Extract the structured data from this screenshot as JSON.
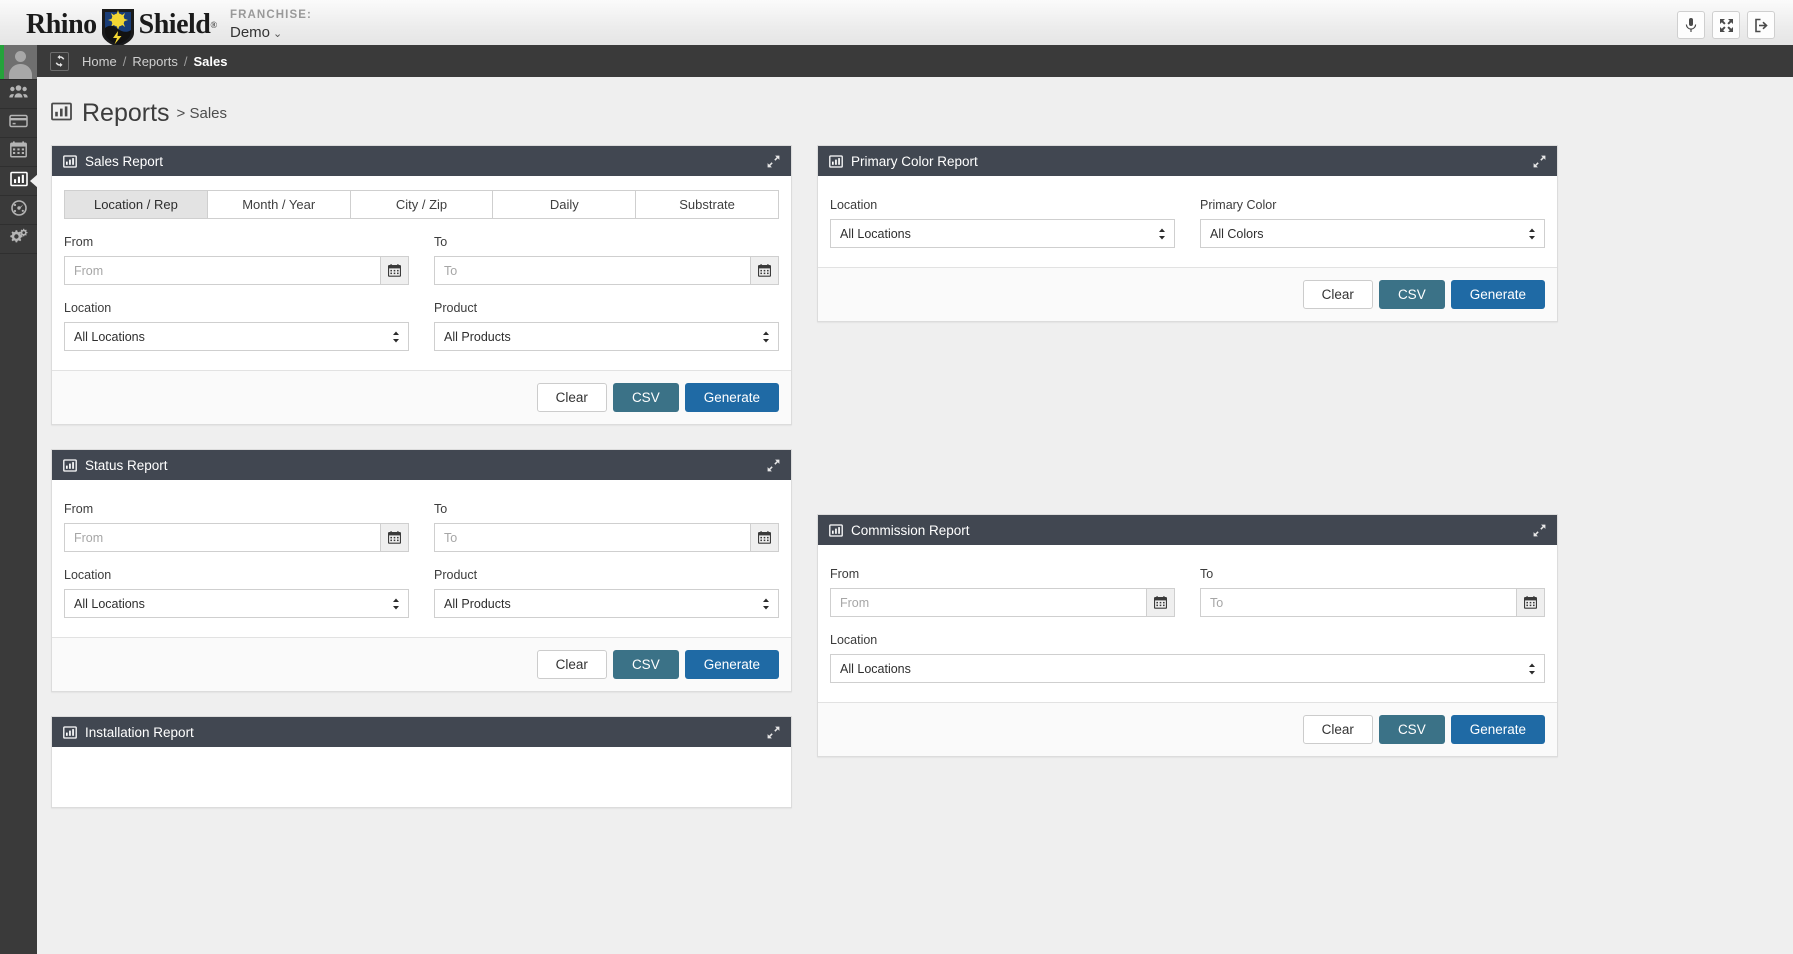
{
  "topbar": {
    "logo_text_1": "Rhino",
    "logo_text_2": "Shield",
    "logo_tm": "®",
    "franchise_label": "FRANCHISE:",
    "franchise_value": "Demo",
    "franchise_caret": "⌄",
    "actions": [
      {
        "name": "microphone-icon",
        "title": "Voice"
      },
      {
        "name": "fullscreen-icon",
        "title": "Fullscreen"
      },
      {
        "name": "logout-icon",
        "title": "Logout"
      }
    ]
  },
  "sidebar": {
    "items": [
      {
        "name": "avatar",
        "label": "User Avatar"
      },
      {
        "name": "sidebar-item-customers",
        "label": "Customers"
      },
      {
        "name": "sidebar-item-payments",
        "label": "Payments"
      },
      {
        "name": "sidebar-item-calendar",
        "label": "Calendar"
      },
      {
        "name": "sidebar-item-reports",
        "label": "Reports",
        "active": true
      },
      {
        "name": "sidebar-item-dashboard",
        "label": "Dashboard"
      },
      {
        "name": "sidebar-item-settings",
        "label": "Settings"
      }
    ]
  },
  "breadcrumb": {
    "refresh": "⟳",
    "home": "Home",
    "sep": "/",
    "reports": "Reports",
    "current": "Sales"
  },
  "page": {
    "title": "Reports",
    "subtitle": "> Sales"
  },
  "common": {
    "from_label": "From",
    "to_label": "To",
    "location_label": "Location",
    "product_label": "Product",
    "from_placeholder": "From",
    "to_placeholder": "To",
    "all_locations": "All Locations",
    "all_products": "All Products",
    "clear_label": "Clear",
    "csv_label": "CSV",
    "generate_label": "Generate",
    "expand_icon": "expand-icon"
  },
  "colors": {
    "panel_header": "#414751",
    "sidebar": "#3a3a3a",
    "csv_button": "#3b7287",
    "generate_button": "#1f6aa5",
    "page_background": "#efefef",
    "avatar_status": "#25a33b"
  },
  "panels": {
    "sales_report": {
      "title": "Sales Report",
      "tabs": [
        {
          "label": "Location / Rep",
          "active": true
        },
        {
          "label": "Month / Year",
          "active": false
        },
        {
          "label": "City / Zip",
          "active": false
        },
        {
          "label": "Daily",
          "active": false
        },
        {
          "label": "Substrate",
          "active": false
        }
      ],
      "from_value": "",
      "to_value": "",
      "location_value": "All Locations",
      "product_value": "All Products"
    },
    "primary_color_report": {
      "title": "Primary Color Report",
      "location_label": "Location",
      "primary_color_label": "Primary Color",
      "location_value": "All Locations",
      "primary_color_value": "All Colors"
    },
    "status_report": {
      "title": "Status Report",
      "from_value": "",
      "to_value": "",
      "location_value": "All Locations",
      "product_value": "All Products"
    },
    "commission_report": {
      "title": "Commission Report",
      "from_value": "",
      "to_value": "",
      "location_value": "All Locations"
    },
    "installation_report": {
      "title": "Installation Report"
    }
  }
}
